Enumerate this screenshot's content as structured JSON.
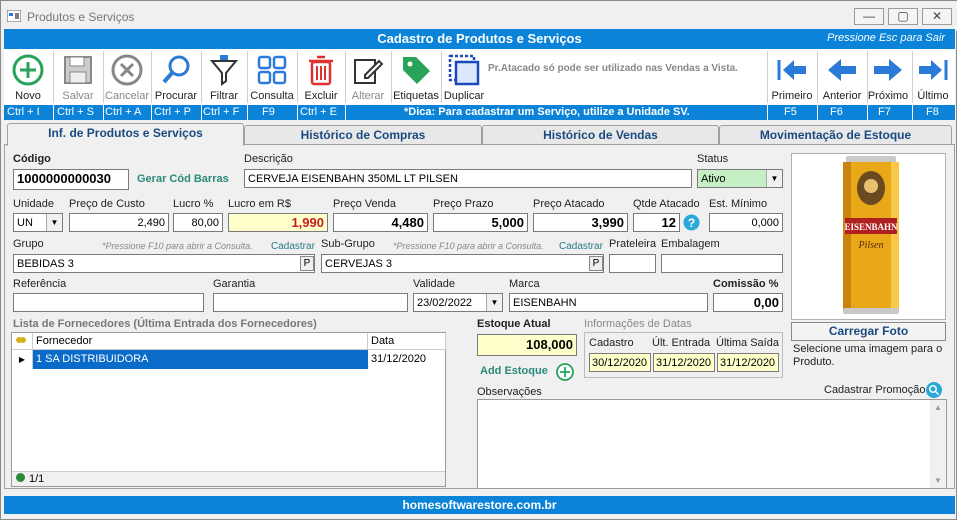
{
  "window": {
    "title": "Produtos e Serviços",
    "min": "—",
    "max": "▢",
    "close": "✕"
  },
  "header": {
    "title": "Cadastro de Produtos e Serviços",
    "esc_hint": "Pressione Esc para Sair"
  },
  "toolbar": {
    "items": [
      {
        "label": "Novo"
      },
      {
        "label": "Salvar"
      },
      {
        "label": "Cancelar"
      },
      {
        "label": "Procurar"
      },
      {
        "label": "Filtrar"
      },
      {
        "label": "Consulta"
      },
      {
        "label": "Excluir"
      },
      {
        "label": "Alterar"
      },
      {
        "label": "Etiquetas"
      },
      {
        "label": "Duplicar"
      },
      {
        "label": "Primeiro"
      },
      {
        "label": "Anterior"
      },
      {
        "label": "Próximo"
      },
      {
        "label": "Último"
      }
    ],
    "note": "Pr.Atacado só pode ser utilizado nas Vendas a Vista."
  },
  "shortcuts": {
    "keys": [
      "Ctrl + I",
      "Ctrl + S",
      "Ctrl + A",
      "Ctrl + P",
      "Ctrl + F",
      "F9",
      "Ctrl + E",
      "F5",
      "F6",
      "F7",
      "F8"
    ],
    "tip": "*Dica: Para cadastrar um Serviço, utilize a Unidade SV."
  },
  "tabs": [
    "Inf. de Produtos e Serviços",
    "Histórico de Compras",
    "Histórico de Vendas",
    "Movimentação de Estoque"
  ],
  "form": {
    "codigo_label": "Código",
    "codigo": "1000000000030",
    "gerar_label": "Gerar Cód Barras",
    "descricao_label": "Descrição",
    "descricao": "CERVEJA EISENBAHN 350ML LT PILSEN",
    "status_label": "Status",
    "status": "Ativo",
    "unidade_label": "Unidade",
    "unidade": "UN",
    "preco_custo_label": "Preço de Custo",
    "preco_custo": "2,490",
    "lucro_pct_label": "Lucro %",
    "lucro_pct": "80,00",
    "lucro_rs_label": "Lucro em R$",
    "lucro_rs": "1,990",
    "preco_venda_label": "Preço Venda",
    "preco_venda": "4,480",
    "preco_prazo_label": "Preço Prazo",
    "preco_prazo": "5,000",
    "preco_atacado_label": "Preço Atacado",
    "preco_atacado": "3,990",
    "qtde_atacado_label": "Qtde Atacado",
    "qtde_atacado": "12",
    "est_min_label": "Est. Mínimo",
    "est_min": "0,000",
    "grupo_label": "Grupo",
    "grupo_hint": "*Pressione F10 para abrir a Consulta.",
    "grupo_link": "Cadastrar",
    "grupo": "BEBIDAS  3",
    "subgrupo_label": "Sub-Grupo",
    "subgrupo_hint": "*Pressione F10 para abrir a Consulta.",
    "subgrupo_link": "Cadastrar",
    "subgrupo": "CERVEJAS  3",
    "prateleira_label": "Prateleira",
    "embalagem_label": "Embalagem",
    "p_btn": "P",
    "referencia_label": "Referência",
    "garantia_label": "Garantia",
    "validade_label": "Validade",
    "validade": "23/02/2022",
    "marca_label": "Marca",
    "marca": "EISENBAHN",
    "comissao_label": "Comissão %",
    "comissao": "0,00"
  },
  "fornecedores": {
    "title": "Lista de Fornecedores (Última Entrada dos Fornecedores)",
    "headers": [
      "Fornecedor",
      "Data"
    ],
    "rows": [
      {
        "fornecedor": "1  SA DISTRIBUIDORA",
        "data": "31/12/2020"
      }
    ],
    "record_count": "1/1"
  },
  "estoque": {
    "label": "Estoque Atual",
    "value": "108,000",
    "add_label": "Add Estoque"
  },
  "datas": {
    "title": "Informações de Datas",
    "cadastro_label": "Cadastro",
    "cadastro": "30/12/2020",
    "entrada_label": "Últ. Entrada",
    "entrada": "31/12/2020",
    "saida_label": "Última Saída",
    "saida": "31/12/2020"
  },
  "foto": {
    "button": "Carregar Foto",
    "hint": "Selecione uma imagem para o Produto.",
    "can_brand": "EISENBAHN",
    "can_sub": "Pilsen"
  },
  "promocao": {
    "label": "Cadastrar Promoção"
  },
  "obs": {
    "label": "Observações"
  },
  "footer": {
    "text": "homesoftwarestore.com.br"
  },
  "colors": {
    "accent": "#0a83d8",
    "status_green": "#c6efc6",
    "yellow_field": "#ffffcc",
    "selected_row": "#0a6cc8"
  }
}
